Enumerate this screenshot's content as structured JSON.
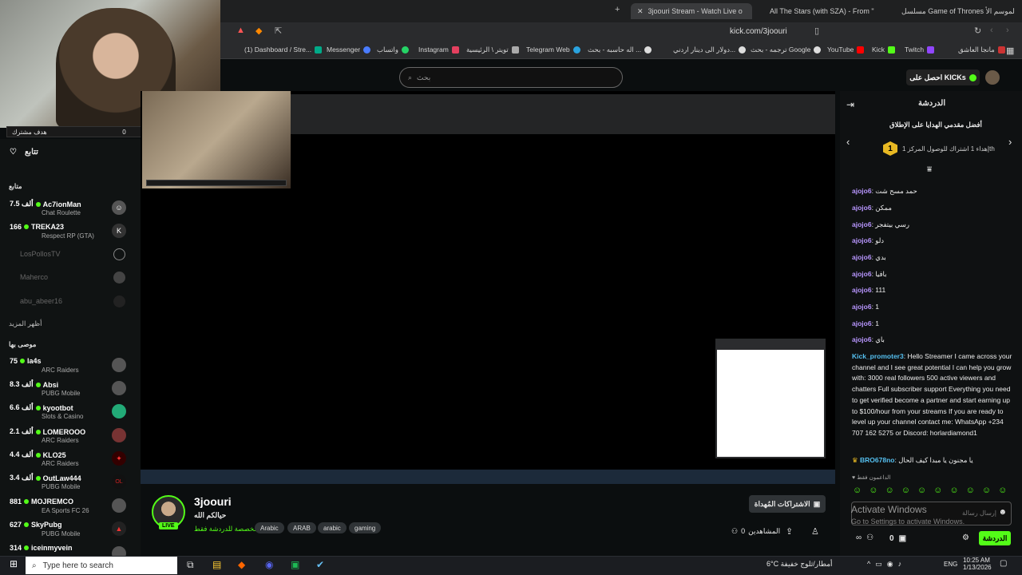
{
  "browser": {
    "tabs": [
      {
        "label": "3joouri Stream - Watch Live o"
      },
      {
        "label": "All The Stars (with SZA) - From \""
      },
      {
        "label": "مسلسل Game of Thrones الموسم الأ"
      }
    ],
    "url": "kick.com/3joouri",
    "bookmarks": [
      "(1) Dashboard / Stre...",
      "Messenger",
      "واتساب",
      "Instagram",
      "تويتر \\ الرئيسية",
      "Telegram Web",
      "اله حاسبه - بحث ...",
      "دولار الى دينار اردني...",
      "ترجمه - بحث Google",
      "YouTube",
      "Kick",
      "Twitch",
      "مانجا العاشق"
    ]
  },
  "webcam": {
    "goal_label": "هدف مشترك",
    "goal_current": "0",
    "goal_target": "50"
  },
  "header": {
    "search_placeholder": "بحث",
    "get_kicks": "احصل على KICKs"
  },
  "sidebar": {
    "following_title": "تتابع",
    "following_section": "متابع",
    "show_more": "أظهر المزيد",
    "recommended_title": "موصى بها",
    "following": [
      {
        "viewers": "7.5 ألف",
        "name": "Ac7ionMan",
        "game": "Chat Roulette",
        "live": true
      },
      {
        "viewers": "166",
        "name": "TREKA23",
        "game": "Respect RP (GTA)",
        "live": true
      },
      {
        "name": "LosPollosTV",
        "live": false
      },
      {
        "name": "Maherco",
        "live": false
      },
      {
        "name": "abu_abeer16",
        "live": false
      }
    ],
    "recommended": [
      {
        "viewers": "75",
        "name": "la4s",
        "game": "ARC Raiders"
      },
      {
        "viewers": "8.3 ألف",
        "name": "Absi",
        "game": "PUBG Mobile"
      },
      {
        "viewers": "6.6 ألف",
        "name": "kyootbot",
        "game": "Slots & Casino"
      },
      {
        "viewers": "2.1 ألف",
        "name": "LOMEROOO",
        "game": "ARC Raiders"
      },
      {
        "viewers": "4.4 ألف",
        "name": "KLO25",
        "game": "ARC Raiders"
      },
      {
        "viewers": "3.4 ألف",
        "name": "OutLaw444",
        "game": "PUBG Mobile"
      },
      {
        "viewers": "881",
        "name": "MOJREMCO",
        "game": "EA Sports FC 26"
      },
      {
        "viewers": "627",
        "name": "SkyPubg",
        "game": "PUBG Mobile"
      },
      {
        "viewers": "314",
        "name": "iceinmyvein",
        "game": ""
      }
    ]
  },
  "channel": {
    "name": "3joouri",
    "title": "حيالكم الله",
    "category": "مخصصة للدردشة فقط",
    "live_badge": "LIVE",
    "tags": [
      "Arabic",
      "ARAB",
      "arabic",
      "gaming"
    ],
    "gift_subs": "الاشتراكات المُهداة",
    "viewers_label": "المشاهدين",
    "viewers": "0"
  },
  "chat": {
    "title": "الدردشة",
    "leaderboard_title": "أفضل مقدمي الهدايا على الإطلاق",
    "leaderboard_entry": "إهداء 1 اشتراك للوصول المركز 1th",
    "rank": "1",
    "messages": [
      {
        "user": "ajojo6",
        "text": "حمد مسح شت"
      },
      {
        "user": "ajojo6",
        "text": "ممكن"
      },
      {
        "user": "ajojo6",
        "text": "رسي بيتفجر"
      },
      {
        "user": "ajojo6",
        "text": "دلو"
      },
      {
        "user": "ajojo6",
        "text": "بدي"
      },
      {
        "user": "ajojo6",
        "text": "بافيا"
      },
      {
        "user": "ajojo6",
        "text": "111"
      },
      {
        "user": "ajojo6",
        "text": "1"
      },
      {
        "user": "ajojo6",
        "text": "1"
      },
      {
        "user": "ajojo6",
        "text": "باي"
      }
    ],
    "promo_user": "Kick_promoter3",
    "promo_text": "Hello Streamer I came across your channel and I see great potential I can help you grow with: 3000 real followers 500 active viewers and chatters Full subscriber support Everything you need to get verified become a partner and start earning up to $100/hour from your streams If you are ready to level up your channel contact me: WhatsApp +234 707 162 5275 or Discord: horlardiamond1",
    "last_user": "BRO678no",
    "last_text": "يا مجنون يا مبدا كيف الحال",
    "supporters_label": "الداعمون فقط",
    "input_placeholder": "إرسال رسالة",
    "send_label": "الدردشة",
    "kicks_count": "0"
  },
  "watermark": {
    "line1": "Activate Windows",
    "line2": "Go to Settings to activate Windows."
  },
  "taskbar": {
    "search": "Type here to search",
    "weather": "6°C  أمطار/ثلوج خفيفة",
    "lang": "ENG",
    "time": "10:25 AM",
    "date": "1/13/2026"
  }
}
